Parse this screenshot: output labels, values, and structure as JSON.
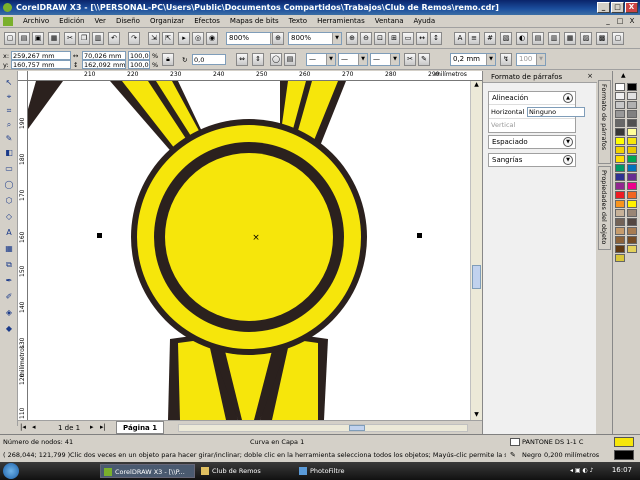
{
  "window": {
    "title": "CorelDRAW X3 - [\\\\PERSONAL-PC\\Users\\Public\\Documentos Compartidos\\Trabajos\\Club de Remos\\remo.cdr]",
    "minimize": "_",
    "maximize": "□",
    "close": "X"
  },
  "menu": [
    "Archivo",
    "Edición",
    "Ver",
    "Diseño",
    "Organizar",
    "Efectos",
    "Mapas de bits",
    "Texto",
    "Herramientas",
    "Ventana",
    "Ayuda"
  ],
  "toolbar": {
    "zoom1": "800%",
    "zoom2": "800%"
  },
  "property_bar": {
    "x": "259,267 mm",
    "y": "160,757 mm",
    "width": "70,026 mm",
    "height": "162,092 mm",
    "scale_x": "100,0",
    "scale_y": "100,0",
    "scale_unit": "%",
    "rotation": "0,0",
    "outline_width": "0,2 mm",
    "value_100": "100"
  },
  "ruler": {
    "h_ticks": [
      "210",
      "220",
      "230",
      "240",
      "250",
      "260",
      "270",
      "280",
      "290",
      "300"
    ],
    "h_unit": "milímetros",
    "v_ticks": [
      "190",
      "180",
      "170",
      "160",
      "150",
      "140",
      "130",
      "120",
      "110"
    ],
    "v_unit": "milímetros"
  },
  "page_nav": {
    "counter": "1 de 1",
    "tab": "Página 1"
  },
  "docker": {
    "title": "Formato de párrafos",
    "alignment_header": "Alineación",
    "horizontal_label": "Horizontal",
    "horizontal_value": "Ninguno",
    "vertical_label": "Vertical",
    "spacing_header": "Espaciado",
    "indent_header": "Sangrías",
    "tab_format": "Formato de párrafos",
    "tab_props": "Propiedades del objeto"
  },
  "palette_colors": [
    "#ffffff",
    "#000000",
    "#f0f0f0",
    "#e0e0e0",
    "#c8c8c8",
    "#b0b0b0",
    "#989898",
    "#808080",
    "#686868",
    "#505050",
    "#383838",
    "#ffff99",
    "#ffff00",
    "#f6e60b",
    "#f2d200",
    "#e8c800",
    "#ffdd00",
    "#00a651",
    "#009966",
    "#0072bc",
    "#2e3192",
    "#662d91",
    "#92278f",
    "#ec008c",
    "#ed1c24",
    "#f26522",
    "#f7941d",
    "#fff200",
    "#c7b299",
    "#998675",
    "#736357",
    "#534741",
    "#c69c6d",
    "#a67c52",
    "#8c6239",
    "#754c24",
    "#603913",
    "#e4d25c",
    "#d9c63a"
  ],
  "status": {
    "nodes": "Número de nodos: 41",
    "curve": "Curva en Capa 1",
    "coords": "( 268,044; 121,799 )",
    "hint": "Clic dos veces en un objeto para hacer girar/inclinar; doble clic en la herramienta selecciona todos los objetos; Mayús-clic permite la selección ...",
    "fill_name": "PANTONE DS 1-1 C",
    "outline_name": "Negro",
    "outline_width": "0,200 milímetros",
    "fill_color": "#f6e60b",
    "outline_color": "#000000"
  },
  "taskbar": {
    "tasks": [
      "CorelDRAW X3 - [\\\\P...",
      "Club de Remos",
      "PhotoFiltre"
    ],
    "clock": "16:07"
  },
  "colors": {
    "gold": "#f6e60b",
    "dark": "#2b211e"
  }
}
